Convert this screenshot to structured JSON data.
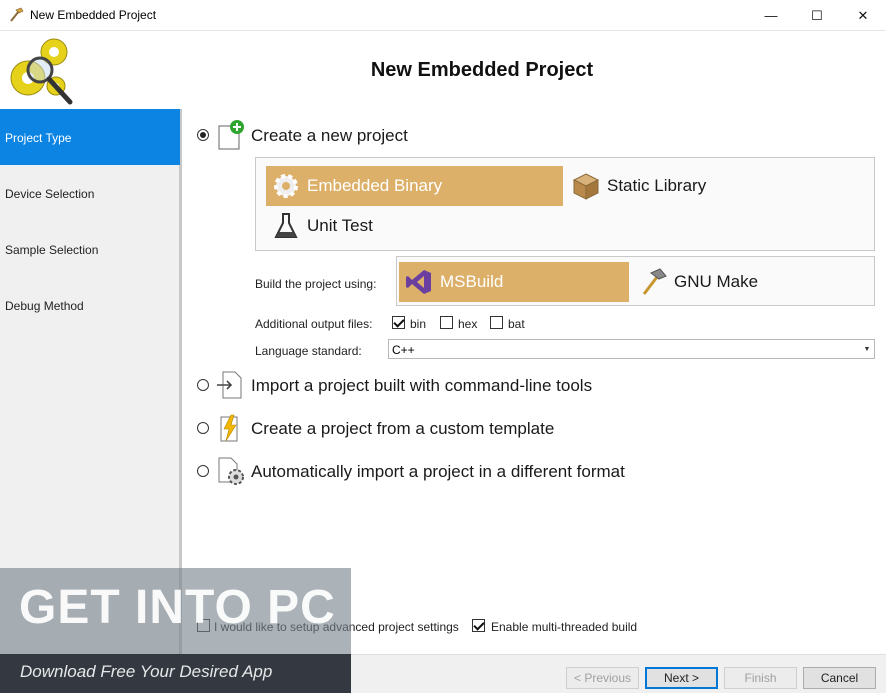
{
  "window": {
    "title": "New Embedded Project",
    "minimize_glyph": "—",
    "maximize_glyph": "☐",
    "close_glyph": "✕"
  },
  "header": {
    "title": "New Embedded Project"
  },
  "sidebar": {
    "items": [
      {
        "label": "Project Type",
        "active": true
      },
      {
        "label": "Device Selection",
        "active": false
      },
      {
        "label": "Sample Selection",
        "active": false
      },
      {
        "label": "Debug Method",
        "active": false
      }
    ]
  },
  "options": {
    "create_new": {
      "label": "Create a new project",
      "selected": true
    },
    "import_cmdline": {
      "label": "Import a project built with command-line tools",
      "selected": false
    },
    "custom_template": {
      "label": "Create a project from a custom template",
      "selected": false
    },
    "auto_import": {
      "label": "Automatically import a project in a different format",
      "selected": false
    }
  },
  "project_types": {
    "embedded_binary": {
      "label": "Embedded Binary",
      "selected": true
    },
    "static_library": {
      "label": "Static Library",
      "selected": false
    },
    "unit_test": {
      "label": "Unit Test",
      "selected": false
    }
  },
  "build": {
    "label": "Build the project using:",
    "msbuild": {
      "label": "MSBuild",
      "selected": true
    },
    "gnu_make": {
      "label": "GNU Make",
      "selected": false
    }
  },
  "output_files": {
    "label": "Additional output files:",
    "bin": {
      "label": "bin",
      "checked": true
    },
    "hex": {
      "label": "hex",
      "checked": false
    },
    "bat": {
      "label": "bat",
      "checked": false
    }
  },
  "language": {
    "label": "Language standard:",
    "value": "C++"
  },
  "footer_checks": {
    "advanced": {
      "label": "I would like to setup advanced project settings",
      "checked": false
    },
    "multithreaded": {
      "label": "Enable multi-threaded build",
      "checked": true
    }
  },
  "buttons": {
    "previous": "< Previous",
    "next": "Next >",
    "finish": "Finish",
    "cancel": "Cancel"
  },
  "watermark": {
    "title": "GET INTO PC",
    "subtitle": "Download Free Your Desired App"
  },
  "colors": {
    "sidebar_active": "#0c84e4",
    "tile_selected": "#dcb068"
  }
}
